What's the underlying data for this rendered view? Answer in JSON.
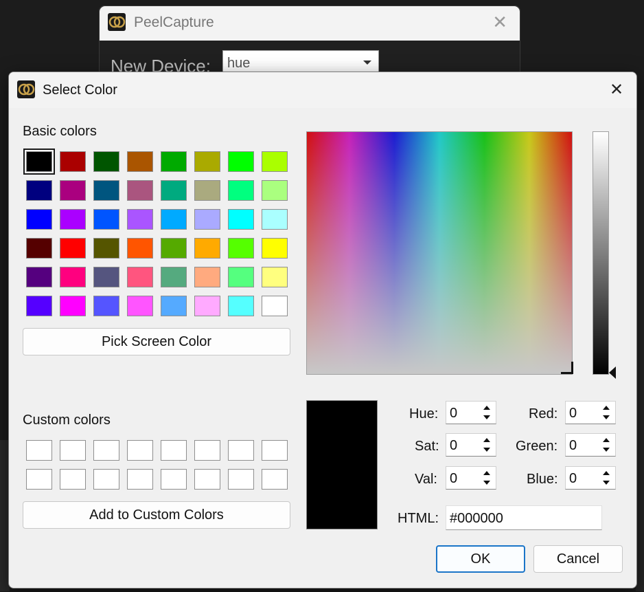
{
  "background_window": {
    "title": "PeelCapture",
    "close_glyph": "✕",
    "new_device_label": "New Device:",
    "device_value": "hue"
  },
  "dialog": {
    "title": "Select Color",
    "close_glyph": "✕",
    "basic_colors_label": "Basic colors",
    "basic_colors": [
      "#000000",
      "#aa0000",
      "#005500",
      "#aa5500",
      "#00aa00",
      "#aaaa00",
      "#00ff00",
      "#aaff00",
      "#00007f",
      "#aa007f",
      "#00557f",
      "#aa557f",
      "#00aa7f",
      "#aaaa7f",
      "#00ff7f",
      "#aaff7f",
      "#0000ff",
      "#aa00ff",
      "#0055ff",
      "#aa55ff",
      "#00aaff",
      "#aaaaff",
      "#00ffff",
      "#aaffff",
      "#550000",
      "#ff0000",
      "#555500",
      "#ff5500",
      "#55aa00",
      "#ffaa00",
      "#55ff00",
      "#ffff00",
      "#55007f",
      "#ff007f",
      "#55557f",
      "#ff557f",
      "#55aa7f",
      "#ffaa7f",
      "#55ff7f",
      "#ffff7f",
      "#5500ff",
      "#ff00ff",
      "#5555ff",
      "#ff55ff",
      "#55aaff",
      "#ffaaff",
      "#55ffff",
      "#ffffff"
    ],
    "selected_basic_index": 0,
    "pick_screen_color_label": "Pick Screen Color",
    "custom_colors_label": "Custom colors",
    "custom_colors": [
      "#ffffff",
      "#ffffff",
      "#ffffff",
      "#ffffff",
      "#ffffff",
      "#ffffff",
      "#ffffff",
      "#ffffff",
      "#ffffff",
      "#ffffff",
      "#ffffff",
      "#ffffff",
      "#ffffff",
      "#ffffff",
      "#ffffff",
      "#ffffff"
    ],
    "add_custom_label": "Add to Custom Colors",
    "current_color": "#000000",
    "fields": {
      "hue": {
        "label": "Hue:",
        "value": "0"
      },
      "sat": {
        "label": "Sat:",
        "value": "0"
      },
      "val": {
        "label": "Val:",
        "value": "0"
      },
      "red": {
        "label": "Red:",
        "value": "0"
      },
      "green": {
        "label": "Green:",
        "value": "0"
      },
      "blue": {
        "label": "Blue:",
        "value": "0"
      }
    },
    "html_label": "HTML:",
    "html_value": "#000000",
    "ok_label": "OK",
    "cancel_label": "Cancel"
  }
}
